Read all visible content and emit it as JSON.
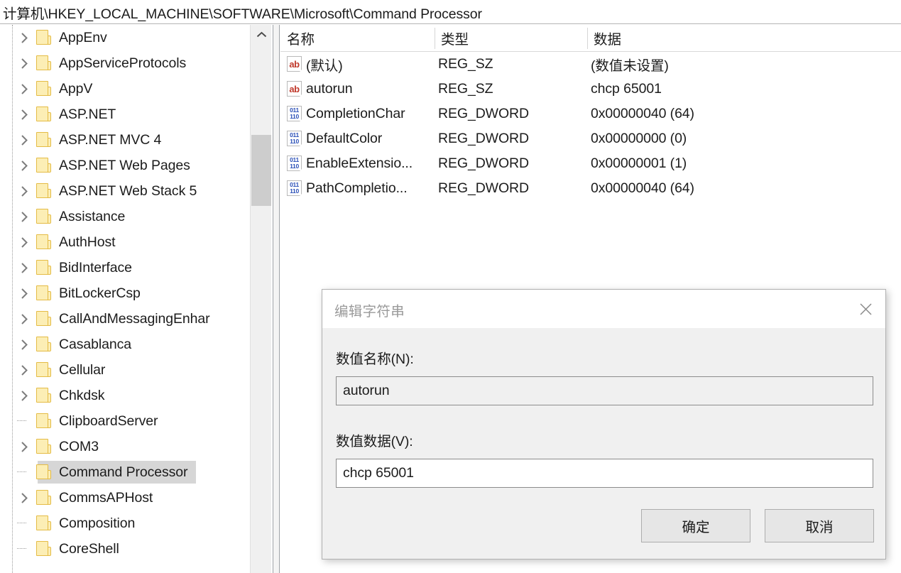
{
  "address": {
    "path": "计算机\\HKEY_LOCAL_MACHINE\\SOFTWARE\\Microsoft\\Command Processor"
  },
  "tree": {
    "items": [
      {
        "label": "AppEnv",
        "expandable": true,
        "selected": false
      },
      {
        "label": "AppServiceProtocols",
        "expandable": true,
        "selected": false
      },
      {
        "label": "AppV",
        "expandable": true,
        "selected": false
      },
      {
        "label": "ASP.NET",
        "expandable": true,
        "selected": false
      },
      {
        "label": "ASP.NET MVC 4",
        "expandable": true,
        "selected": false
      },
      {
        "label": "ASP.NET Web Pages",
        "expandable": true,
        "selected": false
      },
      {
        "label": "ASP.NET Web Stack 5",
        "expandable": true,
        "selected": false
      },
      {
        "label": "Assistance",
        "expandable": true,
        "selected": false
      },
      {
        "label": "AuthHost",
        "expandable": true,
        "selected": false
      },
      {
        "label": "BidInterface",
        "expandable": true,
        "selected": false
      },
      {
        "label": "BitLockerCsp",
        "expandable": true,
        "selected": false
      },
      {
        "label": "CallAndMessagingEnhar",
        "expandable": true,
        "selected": false
      },
      {
        "label": "Casablanca",
        "expandable": true,
        "selected": false
      },
      {
        "label": "Cellular",
        "expandable": true,
        "selected": false
      },
      {
        "label": "Chkdsk",
        "expandable": true,
        "selected": false
      },
      {
        "label": "ClipboardServer",
        "expandable": false,
        "selected": false
      },
      {
        "label": "COM3",
        "expandable": true,
        "selected": false
      },
      {
        "label": "Command Processor",
        "expandable": false,
        "selected": true
      },
      {
        "label": "CommsAPHost",
        "expandable": true,
        "selected": false
      },
      {
        "label": "Composition",
        "expandable": false,
        "selected": false
      },
      {
        "label": "CoreShell",
        "expandable": false,
        "selected": false
      }
    ],
    "scrollbar": {
      "up_arrow_icon": "chevron-up-icon"
    }
  },
  "values": {
    "columns": [
      "名称",
      "类型",
      "数据"
    ],
    "rows": [
      {
        "icon": "string-value-icon",
        "icon_glyph": "ab",
        "name": "(默认)",
        "type": "REG_SZ",
        "data": "(数值未设置)"
      },
      {
        "icon": "string-value-icon",
        "icon_glyph": "ab",
        "name": "autorun",
        "type": "REG_SZ",
        "data": "chcp 65001"
      },
      {
        "icon": "dword-value-icon",
        "icon_glyph": "011110",
        "name": "CompletionChar",
        "type": "REG_DWORD",
        "data": "0x00000040 (64)"
      },
      {
        "icon": "dword-value-icon",
        "icon_glyph": "011110",
        "name": "DefaultColor",
        "type": "REG_DWORD",
        "data": "0x00000000 (0)"
      },
      {
        "icon": "dword-value-icon",
        "icon_glyph": "011110",
        "name": "EnableExtensio...",
        "type": "REG_DWORD",
        "data": "0x00000001 (1)"
      },
      {
        "icon": "dword-value-icon",
        "icon_glyph": "011110",
        "name": "PathCompletio...",
        "type": "REG_DWORD",
        "data": "0x00000040 (64)"
      }
    ]
  },
  "dialog": {
    "title": "编辑字符串",
    "close_icon": "close-icon",
    "name_label": "数值名称(N):",
    "name_value": "autorun",
    "data_label": "数值数据(V):",
    "data_value": "chcp 65001",
    "ok_label": "确定",
    "cancel_label": "取消"
  },
  "colors": {
    "folder_fill": "#fceeb5",
    "folder_border": "#e4bb45",
    "selection": "#d6d6d6",
    "string_icon": "#c0392b",
    "dword_icon": "#2a4fb7",
    "dialog_body": "#f0f0f0"
  }
}
